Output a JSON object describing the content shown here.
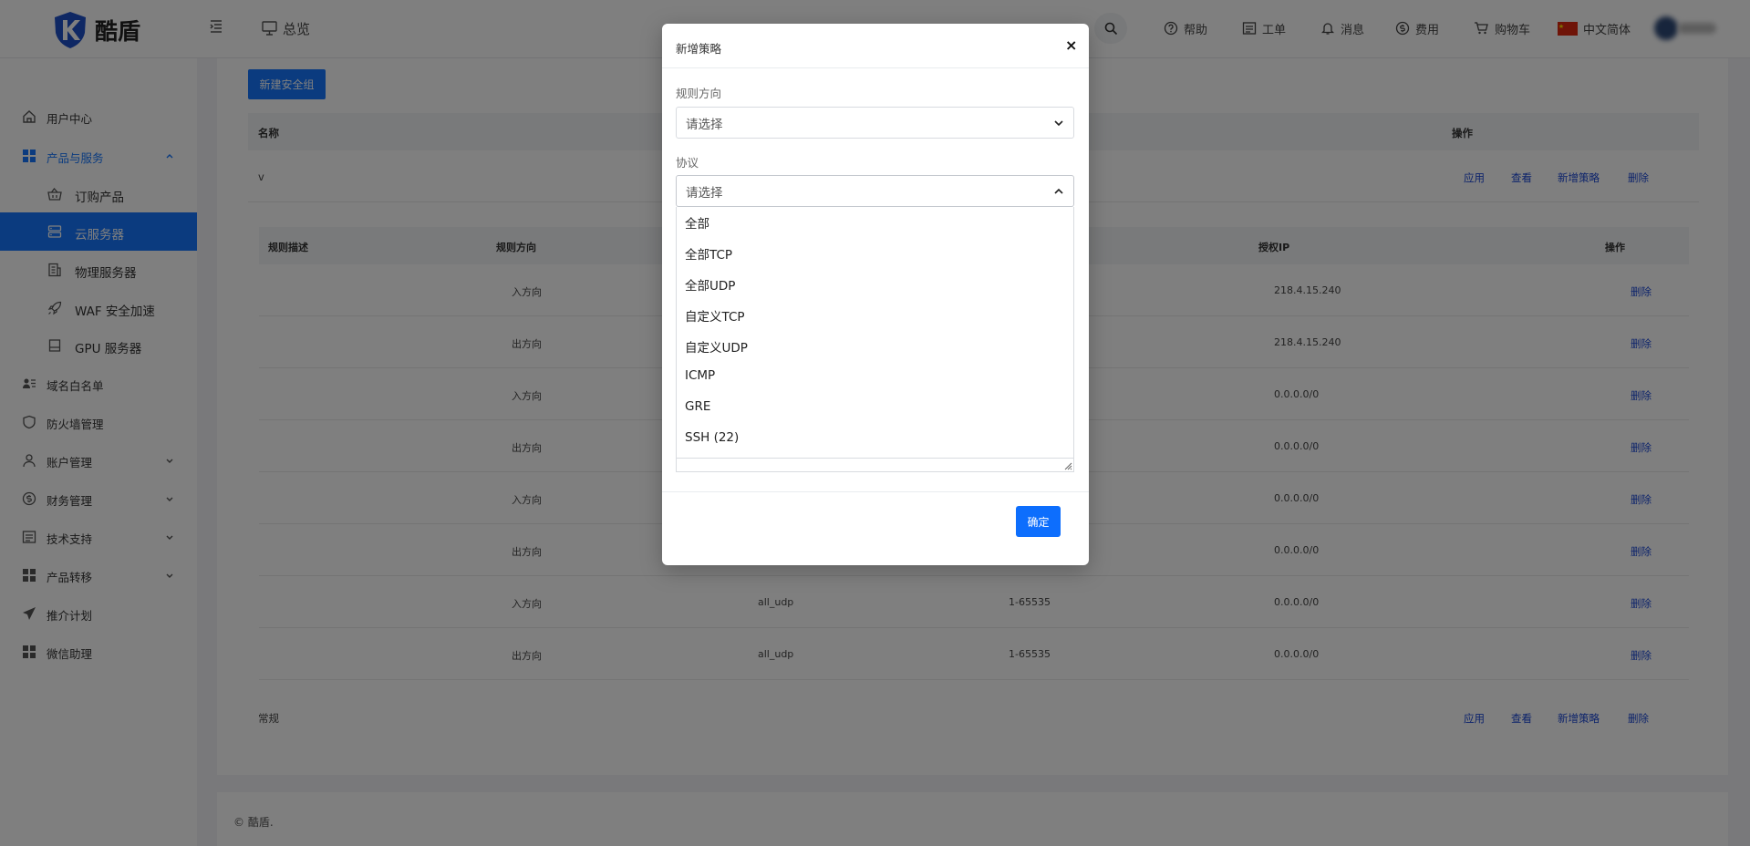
{
  "header": {
    "logo_text": "酷盾",
    "overview": "总览",
    "help": "帮助",
    "ticket": "工单",
    "message": "消息",
    "fee": "费用",
    "cart": "购物车",
    "language": "中文简体"
  },
  "sidebar": {
    "items": [
      {
        "label": "用户中心",
        "icon": "home-icon"
      },
      {
        "label": "产品与服务",
        "icon": "grid-icon"
      },
      {
        "label": "订购产品",
        "icon": "basket-icon"
      },
      {
        "label": "云服务器",
        "icon": "server-icon"
      },
      {
        "label": "物理服务器",
        "icon": "document-server-icon"
      },
      {
        "label": "WAF 安全加速",
        "icon": "rocket-icon"
      },
      {
        "label": "GPU 服务器",
        "icon": "drive-icon"
      },
      {
        "label": "域名白名单",
        "icon": "user-list-icon"
      },
      {
        "label": "防火墙管理",
        "icon": "shield-icon"
      },
      {
        "label": "账户管理",
        "icon": "user-icon"
      },
      {
        "label": "财务管理",
        "icon": "dollar-icon"
      },
      {
        "label": "技术支持",
        "icon": "list-icon"
      },
      {
        "label": "产品转移",
        "icon": "grid-icon"
      },
      {
        "label": "推介计划",
        "icon": "send-icon"
      },
      {
        "label": "微信助理",
        "icon": "grid-icon"
      }
    ]
  },
  "main": {
    "new_group_button": "新建安全组",
    "group_table": {
      "col_name": "名称",
      "col_actions": "操作",
      "groups": [
        {
          "name": "v",
          "actions": [
            "应用",
            "查看",
            "新增策略",
            "删除"
          ]
        },
        {
          "name": "常规",
          "actions": [
            "应用",
            "查看",
            "新增策略",
            "删除"
          ]
        }
      ]
    },
    "rules_table": {
      "headers": [
        "规则描述",
        "规则方向",
        "授权IP",
        "操作"
      ],
      "rows": [
        {
          "direction": "入方向",
          "protocol": "",
          "port": "",
          "ip": "218.4.15.240",
          "action": "删除"
        },
        {
          "direction": "出方向",
          "protocol": "",
          "port": "",
          "ip": "218.4.15.240",
          "action": "删除"
        },
        {
          "direction": "入方向",
          "protocol": "",
          "port": "",
          "ip": "0.0.0.0/0",
          "action": "删除"
        },
        {
          "direction": "出方向",
          "protocol": "",
          "port": "",
          "ip": "0.0.0.0/0",
          "action": "删除"
        },
        {
          "direction": "入方向",
          "protocol": "",
          "port": "",
          "ip": "0.0.0.0/0",
          "action": "删除"
        },
        {
          "direction": "出方向",
          "protocol": "",
          "port": "",
          "ip": "0.0.0.0/0",
          "action": "删除"
        },
        {
          "direction": "入方向",
          "protocol": "all_udp",
          "port": "1-65535",
          "ip": "0.0.0.0/0",
          "action": "删除"
        },
        {
          "direction": "出方向",
          "protocol": "all_udp",
          "port": "1-65535",
          "ip": "0.0.0.0/0",
          "action": "删除"
        }
      ]
    }
  },
  "footer": {
    "copyright": "© 酷盾."
  },
  "modal": {
    "title": "新增策略",
    "close": "×",
    "direction_label": "规则方向",
    "direction_value": "请选择",
    "protocol_label": "协议",
    "protocol_value": "请选择",
    "protocol_options": [
      "全部",
      "全部TCP",
      "全部UDP",
      "自定义TCP",
      "自定义UDP",
      "ICMP",
      "GRE",
      "SSH (22)"
    ],
    "confirm": "确定"
  },
  "colors": {
    "primary": "#1677ff",
    "link": "#1a47d6",
    "mask": "rgba(0,0,0,0.5)"
  }
}
